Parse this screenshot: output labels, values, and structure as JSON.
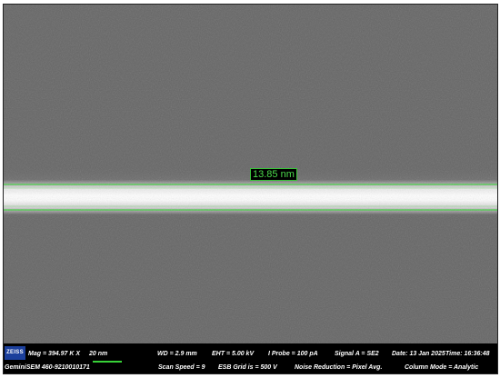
{
  "logo_text": "ZEISS",
  "instrument_id": "GeminiSEM 460-9210010171",
  "measurement": {
    "value_label": "13.85 nm",
    "line_color": "#3fd23f"
  },
  "info": {
    "mag": "Mag =  394.97 K X",
    "scale_label": "20 nm",
    "wd": "WD =  2.9 mm",
    "eht": "EHT =  5.00 kV",
    "iprobe": "I Probe =   100 pA",
    "signal": "Signal A = SE2",
    "date": "Date: 13 Jan 2025",
    "time": "Time: 16:36:48",
    "scan_speed": "Scan Speed = 9",
    "esb_grid": "ESB Grid is =   500 V",
    "noise_reduction": "Noise Reduction = Pixel Avg.",
    "column_mode": "Column Mode = Analytic"
  },
  "colors": {
    "background": "#656565",
    "wire": "#ffffff",
    "info_bar": "#000000",
    "scalebar": "#38d138",
    "logo": "#1b3f9c"
  }
}
